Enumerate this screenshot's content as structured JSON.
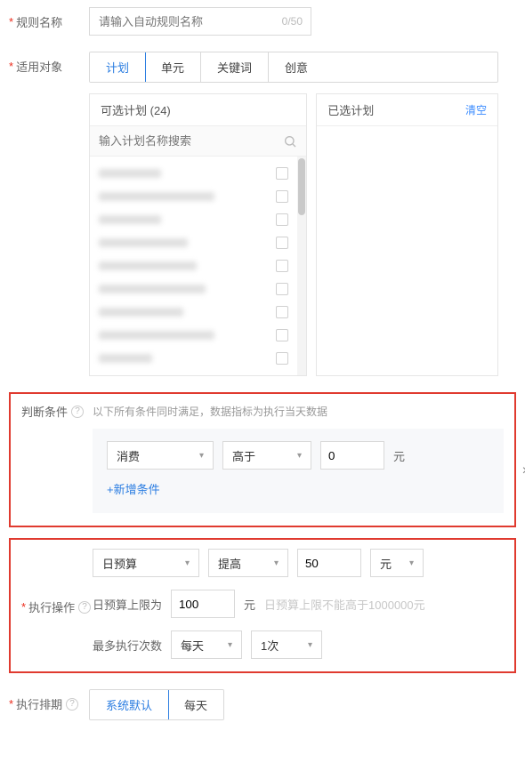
{
  "rule_name": {
    "label": "规则名称",
    "placeholder": "请输入自动规则名称",
    "counter": "0/50",
    "value": ""
  },
  "target": {
    "label": "适用对象",
    "tabs": [
      "计划",
      "单元",
      "关键词",
      "创意"
    ],
    "active_index": 0,
    "left_panel": {
      "title": "可选计划",
      "count": "(24)",
      "search_placeholder": "输入计划名称搜索"
    },
    "right_panel": {
      "title": "已选计划",
      "clear_label": "清空"
    }
  },
  "condition": {
    "label": "判断条件",
    "hint": "以下所有条件同时满足，数据指标为执行当天数据",
    "metric": "消费",
    "operator": "高于",
    "value": "0",
    "unit": "元",
    "add_link": "+新增条件",
    "close": "×"
  },
  "action": {
    "label": "执行操作",
    "metric": "日预算",
    "op": "提高",
    "value": "50",
    "unit": "元",
    "cap_label": "日预算上限为",
    "cap_value": "100",
    "cap_unit": "元",
    "cap_hint": "日预算上限不能高于1000000元",
    "freq_label": "最多执行次数",
    "freq_period": "每天",
    "freq_count": "1次"
  },
  "schedule": {
    "label": "执行排期",
    "tabs": [
      "系统默认",
      "每天"
    ],
    "active_index": 0
  }
}
